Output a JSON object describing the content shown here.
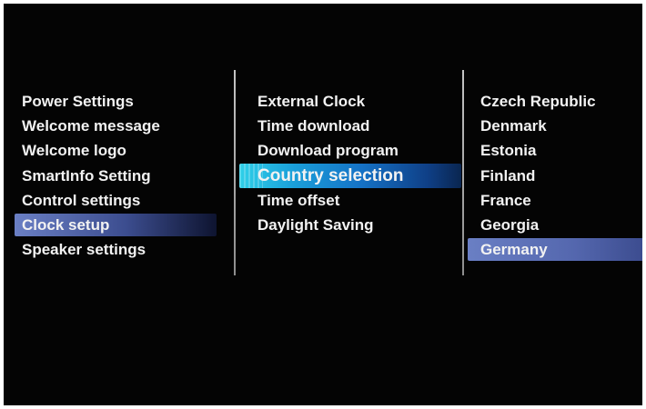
{
  "menu_level_1": {
    "items": [
      {
        "label": "Power Settings"
      },
      {
        "label": "Welcome message"
      },
      {
        "label": "Welcome logo"
      },
      {
        "label": "SmartInfo Setting"
      },
      {
        "label": "Control settings"
      },
      {
        "label": "Clock setup"
      },
      {
        "label": "Speaker settings"
      }
    ],
    "selected": "Clock setup"
  },
  "menu_level_2": {
    "items": [
      {
        "label": "External Clock"
      },
      {
        "label": "Time download"
      },
      {
        "label": "Download program"
      },
      {
        "label": "Country selection"
      },
      {
        "label": "Time offset"
      },
      {
        "label": "Daylight Saving"
      }
    ],
    "focused": "Country selection"
  },
  "menu_level_3": {
    "items": [
      {
        "label": "Czech Republic"
      },
      {
        "label": "Denmark"
      },
      {
        "label": "Estonia"
      },
      {
        "label": "Finland"
      },
      {
        "label": "France"
      },
      {
        "label": "Georgia"
      },
      {
        "label": "Germany"
      }
    ],
    "selected": "Germany"
  },
  "colors": {
    "background": "#040404",
    "text": "#f2f2f2",
    "selection": "#5467ae",
    "focus": "#1a9ed9"
  }
}
